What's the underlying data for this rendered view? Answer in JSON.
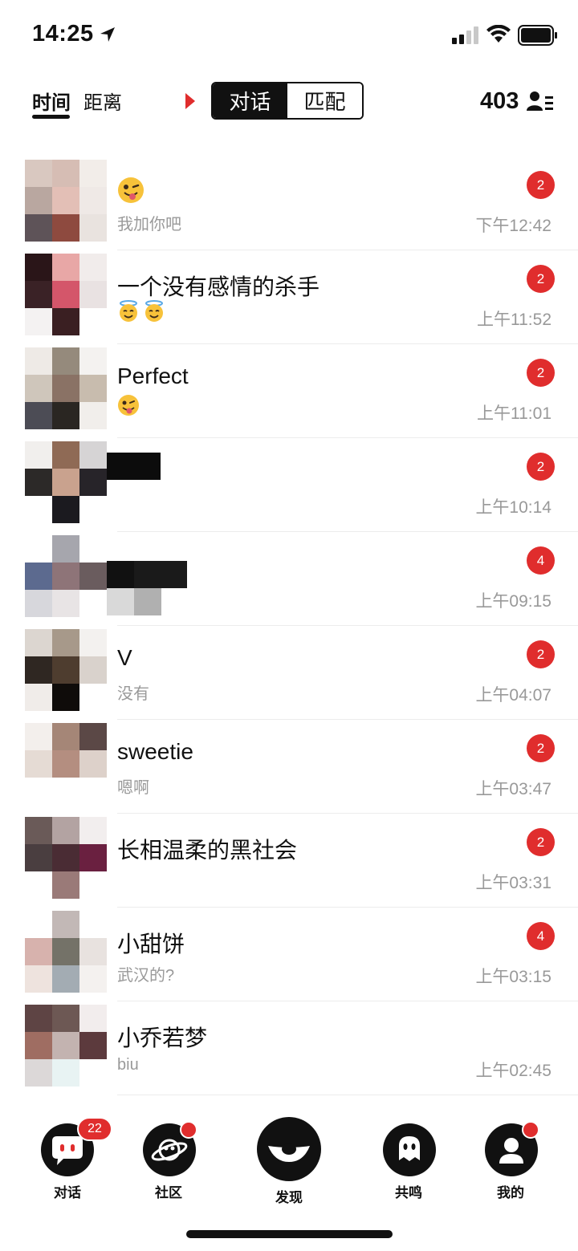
{
  "status_bar": {
    "time": "14:25",
    "icons": [
      "location-arrow-icon",
      "signal-icon",
      "wifi-icon",
      "battery-icon"
    ]
  },
  "header": {
    "sort_tabs": [
      {
        "label": "时间",
        "active": true
      },
      {
        "label": "距离",
        "active": false
      }
    ],
    "segment": [
      {
        "label": "对话",
        "active": true
      },
      {
        "label": "匹配",
        "active": false
      }
    ],
    "count": "403",
    "accent_color": "#e02d2d"
  },
  "conversations": [
    {
      "name": "",
      "message": "我加你吧",
      "time": "下午12:42",
      "badge": "2",
      "name_emoji": "wink-tongue"
    },
    {
      "name": "一个没有感情的杀手",
      "message": "",
      "time": "上午11:52",
      "badge": "2",
      "msg_emoji": [
        "halo",
        "halo"
      ]
    },
    {
      "name": "Perfect",
      "message": "",
      "time": "上午11:01",
      "badge": "2",
      "msg_emoji": [
        "wink-tongue"
      ]
    },
    {
      "name": "",
      "message": "",
      "time": "上午10:14",
      "badge": "2"
    },
    {
      "name": "",
      "message": "",
      "time": "上午09:15",
      "badge": "4"
    },
    {
      "name": "V",
      "message": "没有",
      "time": "上午04:07",
      "badge": "2"
    },
    {
      "name": "sweetie",
      "message": "嗯啊",
      "time": "上午03:47",
      "badge": "2"
    },
    {
      "name": "长相温柔的黑社会",
      "message": "",
      "time": "上午03:31",
      "badge": "2"
    },
    {
      "name": "小甜饼",
      "message": "武汉的?",
      "time": "上午03:15",
      "badge": "4"
    },
    {
      "name": "小乔若梦",
      "message": "biu",
      "time": "上午02:45",
      "badge": ""
    }
  ],
  "tabbar": {
    "items": [
      {
        "label": "对话",
        "badge": "22"
      },
      {
        "label": "社区",
        "dot": true
      },
      {
        "label": "发现"
      },
      {
        "label": "共鸣"
      },
      {
        "label": "我的",
        "dot": true
      }
    ]
  }
}
